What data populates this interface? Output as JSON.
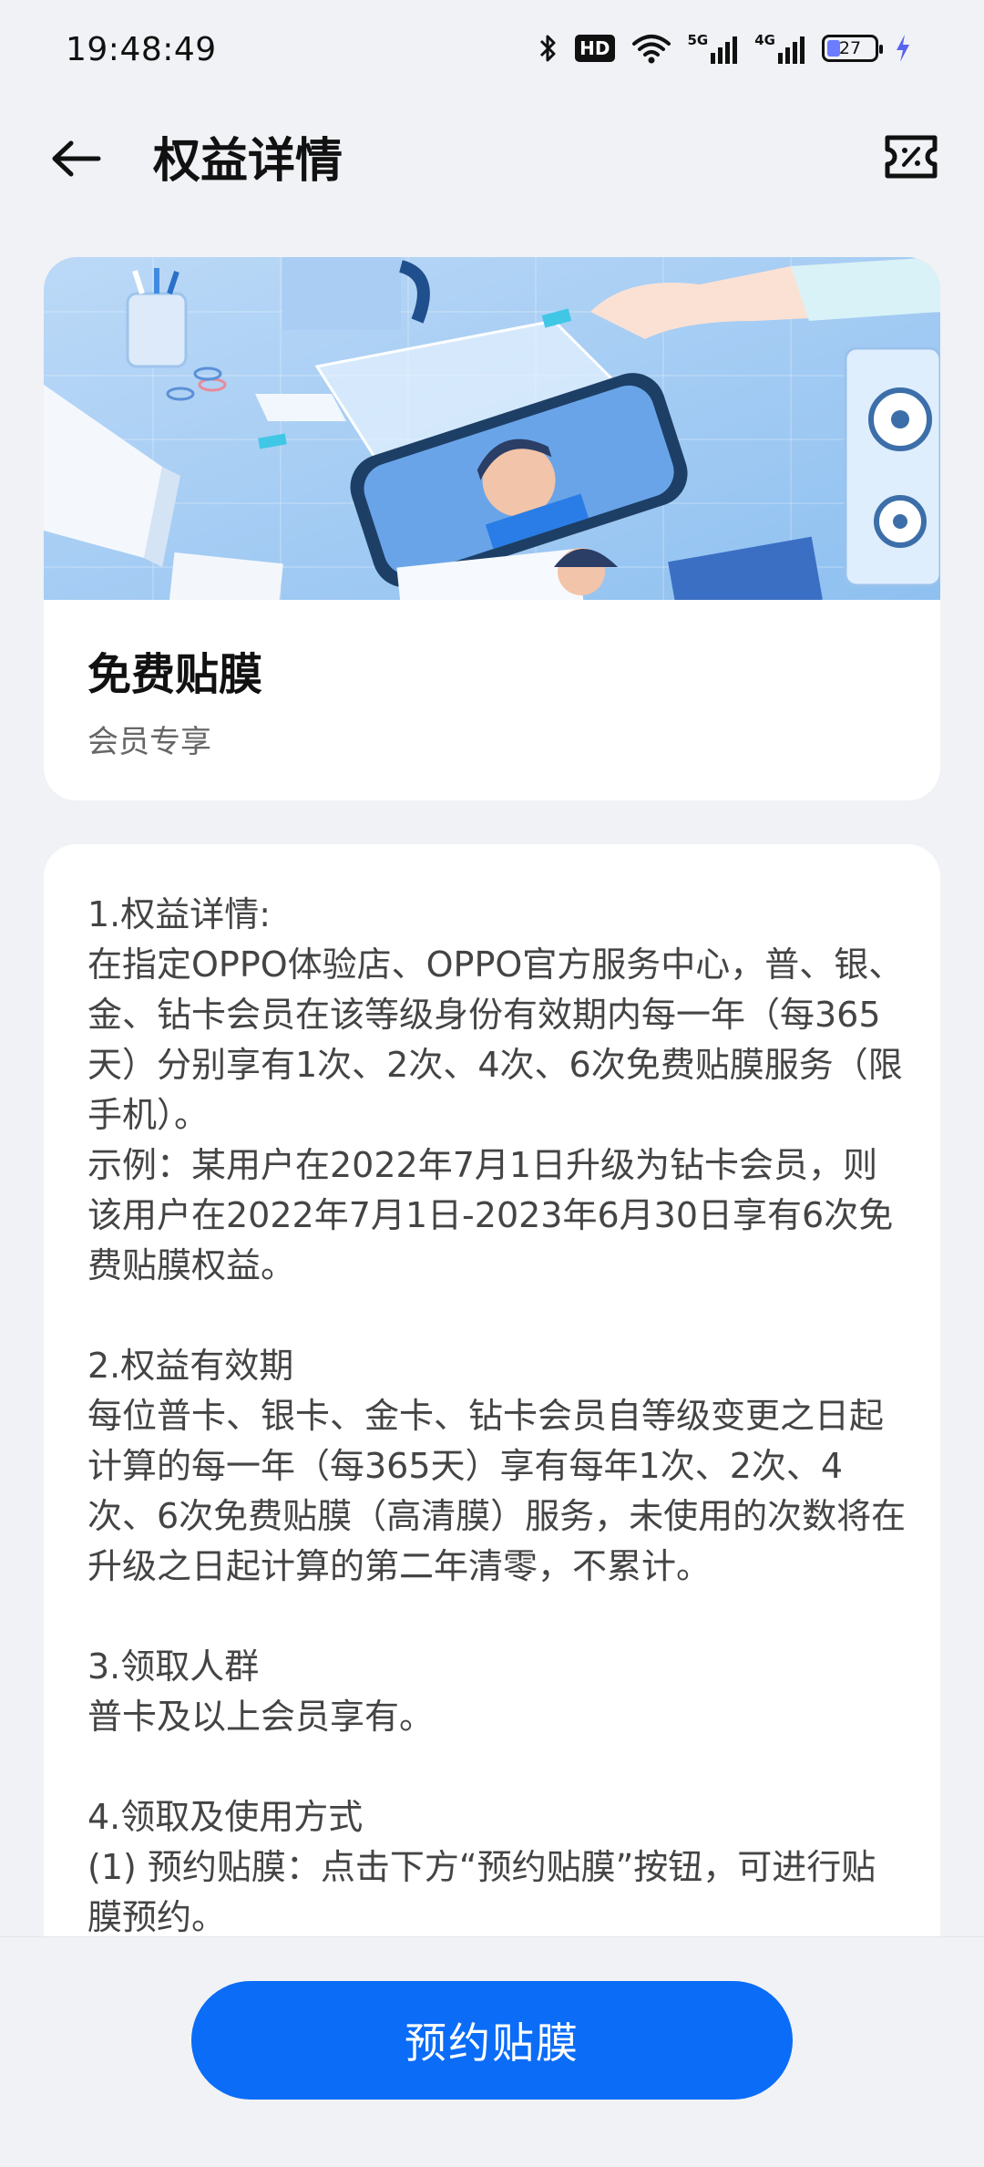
{
  "status_bar": {
    "time": "19:48:49",
    "hd_label": "HD",
    "sig1_label": "5G",
    "sig2_label": "4G",
    "battery_level": "27",
    "battery_percent_fill": 0.27,
    "icons": [
      "bluetooth-icon",
      "hd-icon",
      "wifi-icon",
      "signal-5g-icon",
      "signal-4g-icon",
      "battery-icon",
      "charging-icon"
    ]
  },
  "header": {
    "title": "权益详情",
    "back_icon": "arrow-left-icon",
    "ticket_icon": "coupon-icon"
  },
  "benefit_card": {
    "title": "免费贴膜",
    "subtitle": "会员专享",
    "image": "phone-screen-protector-illustration"
  },
  "details": {
    "sections": [
      {
        "heading": "1.权益详情:",
        "lines": [
          "在指定OPPO体验店、OPPO官方服务中心，普、银、金、钻卡会员在该等级身份有效期内每一年（每365天）分别享有1次、2次、4次、6次免费贴膜服务（限手机）。",
          "示例：某用户在2022年7月1日升级为钻卡会员，则该用户在2022年7月1日-2023年6月30日享有6次免费贴膜权益。"
        ]
      },
      {
        "heading": "2.权益有效期",
        "lines": [
          "每位普卡、银卡、金卡、钻卡会员自等级变更之日起计算的每一年（每365天）享有每年1次、2次、4次、6次免费贴膜（高清膜）服务，未使用的次数将在升级之日起计算的第二年清零，不累计。"
        ]
      },
      {
        "heading": "3.领取人群",
        "lines": [
          "普卡及以上会员享有。"
        ]
      },
      {
        "heading": "4.领取及使用方式",
        "lines": [
          "(1) 预约贴膜：点击下方“预约贴膜”按钮，可进行贴膜预约。"
        ]
      }
    ]
  },
  "bottom": {
    "reserve_label": "预约贴膜"
  },
  "colors": {
    "accent": "#0b6cf7",
    "background": "#f0f2f5",
    "card": "#ffffff"
  }
}
